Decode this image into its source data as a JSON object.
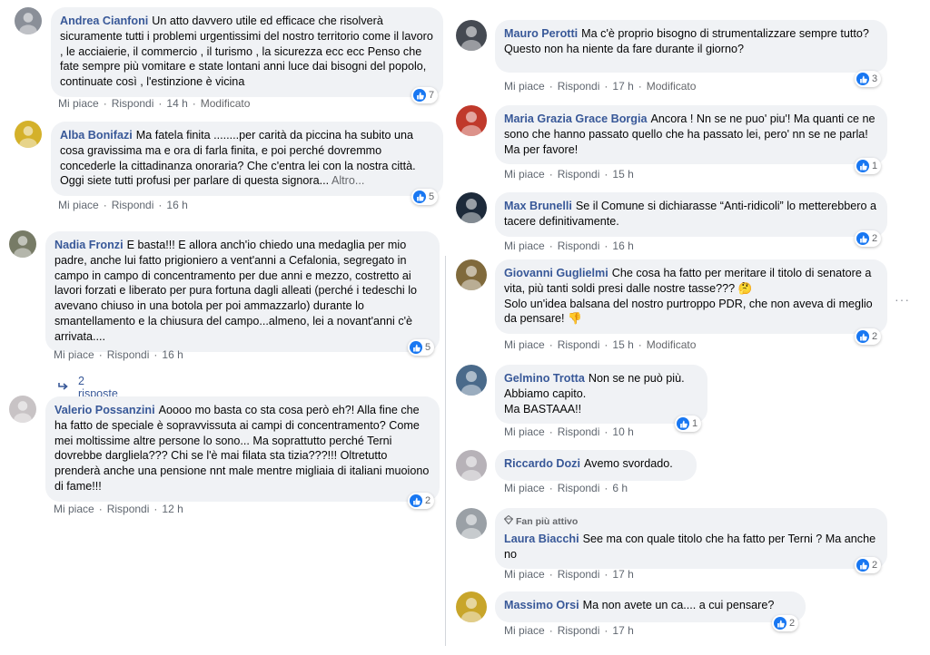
{
  "labels": {
    "like": "Mi piace",
    "reply": "Rispondi",
    "modified": "Modificato",
    "replies_link": "2 risposte",
    "fan_badge": "Fan più attivo",
    "more": "Altro...",
    "options": "···"
  },
  "colors": {
    "name": "#385898",
    "bubble": "#f0f2f5",
    "like": "#1877f2",
    "meta": "#65676b"
  },
  "comments": [
    {
      "name": "Andrea Cianfoni",
      "text": "Un atto davvero utile ed efficace che risolverà sicuramente tutti i problemi urgentissimi del nostro territorio come il lavoro , le acciaierie, il commercio , il turismo , la sicurezza ecc ecc Penso che fate sempre più vomitare e state lontani anni luce dai bisogni del popolo, continuate così , l'estinzione è vicina",
      "time": "14 h",
      "reactions": "7",
      "modified": true
    },
    {
      "name": "Alba Bonifazi",
      "text": "Ma fatela finita ........per carità da piccina ha subito una cosa gravissima ma e ora di farla finita, e poi perché dovremmo concederle la cittadinanza onoraria? Che c'entra lei con la nostra città. Oggi siete tutti profusi per parlare di questa signora...",
      "time": "16 h",
      "reactions": "5"
    },
    {
      "name": "Nadia Fronzi",
      "text": "E basta!!! E allora anch'io chiedo una medaglia per mio padre, anche lui fatto prigioniero a vent'anni a Cefalonia, segregato in campo in campo di concentramento per due anni e mezzo, costretto ai lavori forzati e liberato per pura fortuna dagli alleati (perché i tedeschi lo avevano chiuso in una botola per poi ammazzarlo) durante lo smantellamento e la chiusura del campo...almeno, lei a novant'anni c'è arrivata....",
      "time": "16 h",
      "reactions": "5"
    },
    {
      "name": "Valerio Possanzini",
      "text": "Aoooo mo basta co sta cosa però eh?! Alla fine che ha fatto de speciale è sopravvissuta ai campi di concentramento? Come mei moltissime altre persone lo sono... Ma soprattutto perché Terni dovrebbe dargliela??? Chi se l'è mai filata sta tizia???!!! Oltretutto prenderà anche una pensione nnt male mentre migliaia di italiani muoiono di fame!!!",
      "time": "12 h",
      "reactions": "2"
    },
    {
      "name": "Mauro Perotti",
      "text": "Ma c'è proprio bisogno di strumentalizzare sempre tutto?\nQuesto non ha niente da fare durante il giorno?",
      "time": "17 h",
      "reactions": "3",
      "modified": true
    },
    {
      "name": "Maria Grazia Grace Borgia",
      "text": "Ancora ! Nn se ne puo' piu'! Ma quanti ce ne sono che hanno passato quello che ha passato lei, pero' nn se ne parla! Ma per favore!",
      "time": "15 h",
      "reactions": "1"
    },
    {
      "name": "Max Brunelli",
      "text": "Se il Comune si dichiarasse “Anti-ridicoli” lo metterebbero a tacere definitivamente.",
      "time": "16 h",
      "reactions": "2"
    },
    {
      "name": "Giovanni Guglielmi",
      "text": "Che cosa ha fatto per meritare il titolo di senatore a vita, più tanti soldi presi dalle nostre tasse??? 🤔\nSolo un'idea balsana del nostro purtroppo PDR, che non aveva di meglio da pensare! 👎",
      "time": "15 h",
      "reactions": "2",
      "modified": true
    },
    {
      "name": "Gelmino Trotta",
      "text": "Non se ne può più.\nAbbiamo capito.\nMa BASTAAA!!",
      "time": "10 h",
      "reactions": "1"
    },
    {
      "name": "Riccardo Dozi",
      "text": "Avemo svordado.",
      "time": "6 h"
    },
    {
      "name": "Laura Biacchi",
      "text": "See ma con quale titolo che ha fatto per Terni ? Ma anche no",
      "time": "17 h",
      "reactions": "2",
      "fan": true
    },
    {
      "name": "Massimo Orsi",
      "text": "Ma non avete un ca.... a cui pensare?",
      "time": "17 h",
      "reactions": "2"
    }
  ]
}
